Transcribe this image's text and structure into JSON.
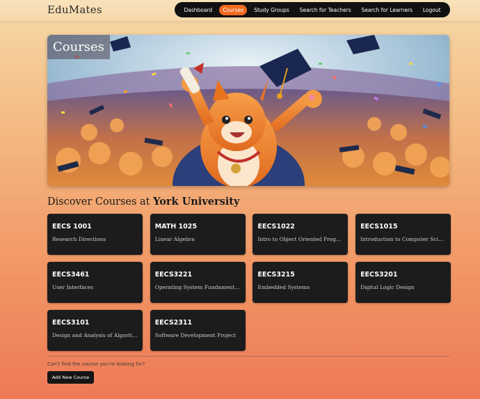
{
  "app": {
    "brand": "EduMates"
  },
  "nav": {
    "items": [
      {
        "label": "Dashboard",
        "active": false
      },
      {
        "label": "Courses",
        "active": true
      },
      {
        "label": "Study Groups",
        "active": false
      },
      {
        "label": "Search for Teachers",
        "active": false
      },
      {
        "label": "Search for Learners",
        "active": false
      },
      {
        "label": "Logout",
        "active": false
      }
    ],
    "accent": "#f26a1f"
  },
  "hero": {
    "title": "Courses"
  },
  "discover": {
    "prefix": "Discover Courses at ",
    "university": "York University"
  },
  "courses": [
    {
      "code": "EECS 1001",
      "name": "Research Directions"
    },
    {
      "code": "MATH 1025",
      "name": "Linear Algebra"
    },
    {
      "code": "EECS1022",
      "name": "Intro to Object Oriented Progra..."
    },
    {
      "code": "EECS1015",
      "name": "Introduction to Computer Scien..."
    },
    {
      "code": "EECS3461",
      "name": "User Interfaces"
    },
    {
      "code": "EECS3221",
      "name": "Operating System Fundamentals"
    },
    {
      "code": "EECS3215",
      "name": "Embedded Systems"
    },
    {
      "code": "EECS3201",
      "name": "Digital Logic Design"
    },
    {
      "code": "EECS3101",
      "name": "Design and Analysis of Algorith..."
    },
    {
      "code": "EECS2311",
      "name": "Software Development Project"
    }
  ],
  "footer": {
    "cant_find": "Can't find the course you're looking for?",
    "add_button": "Add New Course"
  }
}
